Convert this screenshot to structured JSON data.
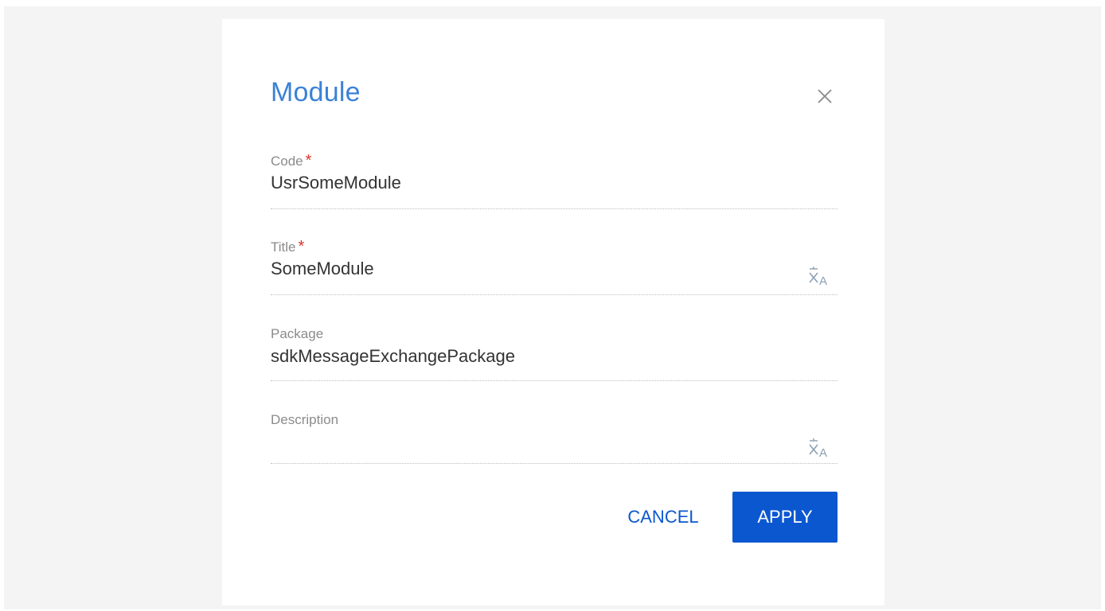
{
  "dialog": {
    "title": "Module",
    "close_icon": "close-icon"
  },
  "fields": {
    "code": {
      "label": "Code",
      "required_mark": "*",
      "value": "UsrSomeModule"
    },
    "title": {
      "label": "Title",
      "required_mark": "*",
      "value": "SomeModule",
      "icon": "translate-icon"
    },
    "package": {
      "label": "Package",
      "value": "sdkMessageExchangePackage"
    },
    "description": {
      "label": "Description",
      "value": "",
      "icon": "translate-icon"
    }
  },
  "actions": {
    "cancel_label": "CANCEL",
    "apply_label": "APPLY"
  },
  "colors": {
    "title": "#3b82d6",
    "primary": "#0b57d0",
    "required": "#d9352b",
    "label": "#8b8b8b",
    "value": "#333333",
    "backdrop": "#f4f4f4"
  }
}
